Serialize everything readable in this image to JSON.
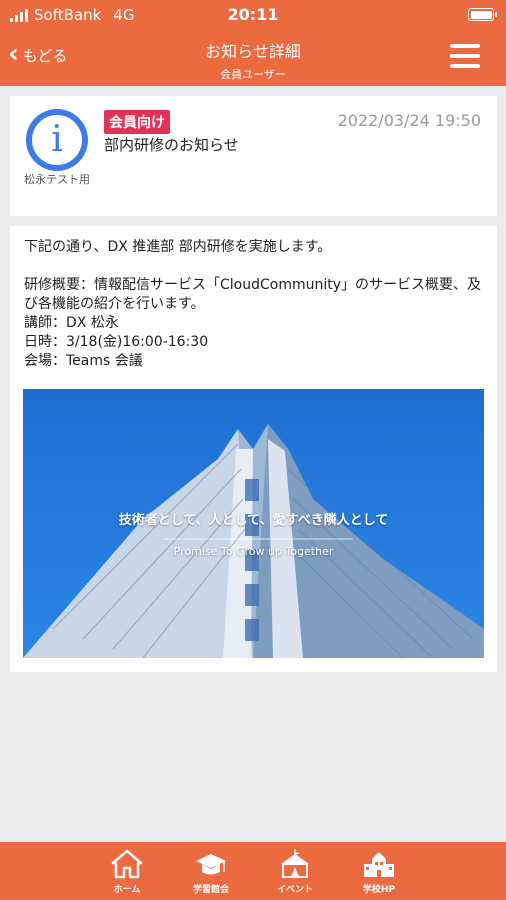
{
  "status_bar": {
    "carrier": "SoftBank",
    "network": "4G",
    "time": "20:11"
  },
  "header": {
    "back_label": "もどる",
    "title": "お知らせ詳細",
    "subtitle": "会員ユーザー"
  },
  "post": {
    "badge": "会員向け",
    "title": "部内研修のお知らせ",
    "date": "2022/03/24 19:50",
    "sender": "松永テスト用",
    "body_lines": [
      "下記の通り、DX 推進部 部内研修を実施します。",
      "",
      "研修概要：情報配信サービス「CloudCommunity」のサービス概要、及び各機能の紹介を行います。",
      "講師：DX 松永",
      "日時：3/18(金)16:00-16:30",
      "会場：Teams 会議"
    ],
    "image_caption": "技術者として、人として、愛すべき隣人として",
    "image_subcaption": "Promise To Grow up Together"
  },
  "footer": {
    "items": [
      {
        "label": "ホーム",
        "icon": "home-icon"
      },
      {
        "label": "学習館会",
        "icon": "graduation-cap-icon"
      },
      {
        "label": "イベント",
        "icon": "tent-icon"
      },
      {
        "label": "学校HP",
        "icon": "school-icon"
      }
    ]
  },
  "colors": {
    "brand": "#ec6a3f",
    "badge": "#e2325a",
    "info_icon": "#3d7be8"
  }
}
